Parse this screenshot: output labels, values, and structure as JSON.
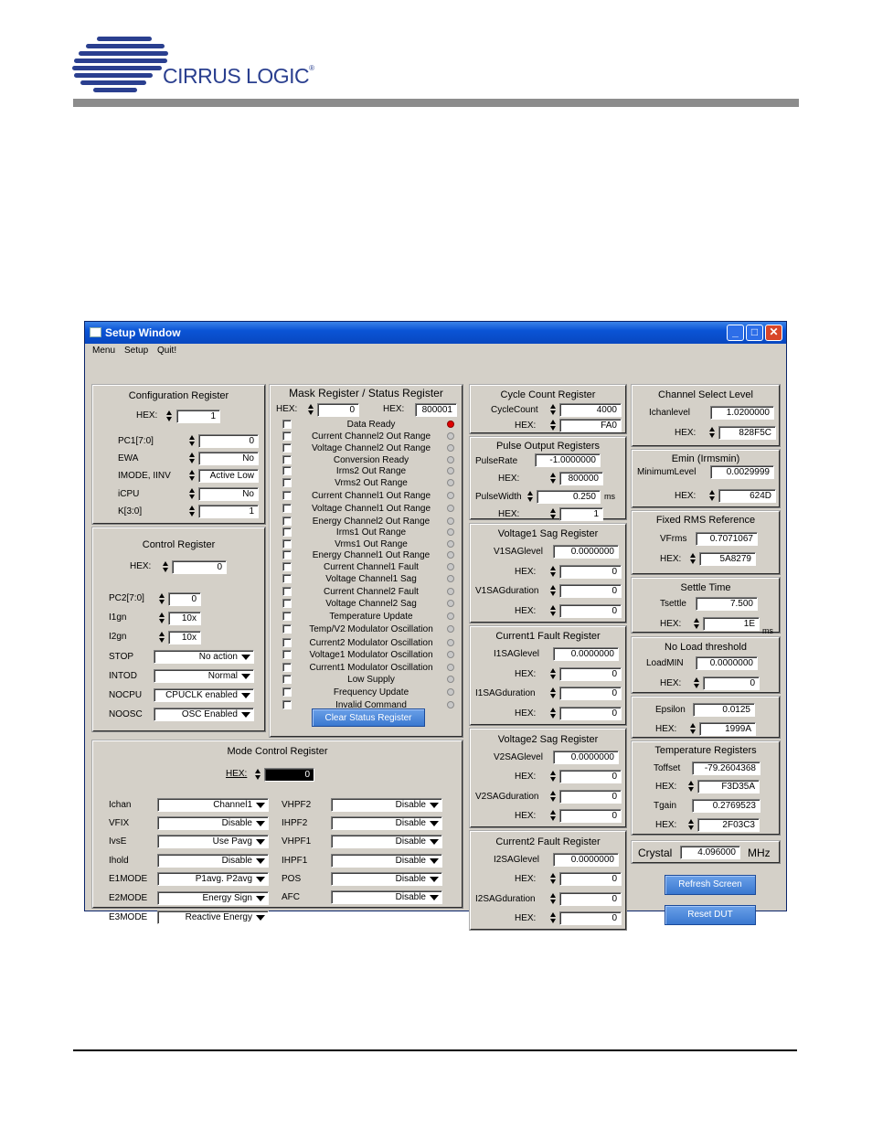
{
  "logo": {
    "text": "CIRRUS LOGIC",
    "mark": "®"
  },
  "window": {
    "title": "Setup Window",
    "minimize": "_",
    "maximize": "□",
    "close": "✕"
  },
  "menu": [
    "Menu",
    "Setup",
    "Quit!"
  ],
  "config": {
    "title": "Configuration Register",
    "hex_label": "HEX:",
    "hex": "1",
    "rows": [
      {
        "label": "PC1[7:0]",
        "value": "0",
        "type": "num"
      },
      {
        "label": "EWA",
        "value": "No",
        "type": "num"
      },
      {
        "label": "IMODE, IINV",
        "value": "Active Low",
        "type": "num"
      },
      {
        "label": "iCPU",
        "value": "No",
        "type": "num"
      },
      {
        "label": "K[3:0]",
        "value": "1",
        "type": "num"
      }
    ]
  },
  "control": {
    "title": "Control Register",
    "hex_label": "HEX:",
    "hex": "0",
    "pc2_label": "PC2[7:0]",
    "pc2": "0",
    "i1gn_label": "I1gn",
    "i1gn": "10x",
    "i2gn_label": "I2gn",
    "i2gn": "10x",
    "rings": [
      {
        "label": "STOP",
        "value": "No action"
      },
      {
        "label": "INTOD",
        "value": "Normal"
      },
      {
        "label": "NOCPU",
        "value": "CPUCLK enabled"
      },
      {
        "label": "NOOSC",
        "value": "OSC Enabled"
      }
    ]
  },
  "mask": {
    "title": "Mask Register / Status Register",
    "hex_label": "HEX:",
    "mask_hex": "0",
    "status_hex_label": "HEX:",
    "status_hex": "800001",
    "items": [
      "Data Ready",
      "Current Channel2 Out Range",
      "Voltage Channel2 Out Range",
      "Conversion Ready",
      "Irms2 Out Range",
      "Vrms2 Out Range",
      "Current Channel1 Out Range",
      "Voltage Channel1 Out Range",
      "Energy Channel2 Out Range",
      "Irms1 Out Range",
      "Vrms1 Out Range",
      "Energy Channel1 Out Range",
      "Current Channel1 Fault",
      "Voltage Channel1 Sag",
      "Current Channel2 Fault",
      "Voltage Channel2 Sag",
      "Temperature Update",
      "Temp/V2 Modulator Oscillation",
      "Current2 Modulator Oscillation",
      "Voltage1 Modulator Oscillation",
      "Current1 Modulator Oscillation",
      "Low Supply",
      "Frequency Update",
      "Invalid Command"
    ],
    "clear_button": "Clear Status Register"
  },
  "mode": {
    "title": "Mode Control Register",
    "hex_label": "HEX:",
    "hex": "0",
    "left": [
      {
        "label": "Ichan",
        "value": "Channel1"
      },
      {
        "label": "VFIX",
        "value": "Disable"
      },
      {
        "label": "IvsE",
        "value": "Use Pavg"
      },
      {
        "label": "Ihold",
        "value": "Disable"
      },
      {
        "label": "E1MODE",
        "value": "P1avg. P2avg"
      },
      {
        "label": "E2MODE",
        "value": "Energy Sign"
      },
      {
        "label": "E3MODE",
        "value": "Reactive Energy"
      }
    ],
    "right": [
      {
        "label": "VHPF2",
        "value": "Disable"
      },
      {
        "label": "IHPF2",
        "value": "Disable"
      },
      {
        "label": "VHPF1",
        "value": "Disable"
      },
      {
        "label": "IHPF1",
        "value": "Disable"
      },
      {
        "label": "POS",
        "value": "Disable"
      },
      {
        "label": "AFC",
        "value": "Disable"
      }
    ]
  },
  "cycle": {
    "title": "Cycle Count Register",
    "count_label": "CycleCount",
    "count": "4000",
    "hex_label": "HEX:",
    "hex": "FA0"
  },
  "pulse": {
    "title": "Pulse Output Registers",
    "rate_label": "PulseRate",
    "rate": "-1.0000000",
    "hex_label": "HEX:",
    "hex": "800000",
    "width_label": "PulseWidth",
    "width": "0.250",
    "width_unit": "ms",
    "hex2_label": "HEX:",
    "hex2": "1"
  },
  "v1sag": {
    "title": "Voltage1 Sag Register",
    "level_label": "V1SAGlevel",
    "level": "0.0000000",
    "hex_label": "HEX:",
    "hex": "0",
    "dur_label": "V1SAGduration",
    "dur": "0",
    "hex2_label": "HEX:",
    "hex2": "0"
  },
  "i1fault": {
    "title": "Current1 Fault Register",
    "level_label": "I1SAGlevel",
    "level": "0.0000000",
    "hex_label": "HEX:",
    "hex": "0",
    "dur_label": "I1SAGduration",
    "dur": "0",
    "hex2_label": "HEX:",
    "hex2": "0"
  },
  "v2sag": {
    "title": "Voltage2 Sag Register",
    "level_label": "V2SAGlevel",
    "level": "0.0000000",
    "hex_label": "HEX:",
    "hex": "0",
    "dur_label": "V2SAGduration",
    "dur": "0",
    "hex2_label": "HEX:",
    "hex2": "0"
  },
  "i2fault": {
    "title": "Current2 Fault Register",
    "level_label": "I2SAGlevel",
    "level": "0.0000000",
    "hex_label": "HEX:",
    "hex": "0",
    "dur_label": "I2SAGduration",
    "dur": "0",
    "hex2_label": "HEX:",
    "hex2": "0"
  },
  "chansel": {
    "title": "Channel Select Level",
    "lvl_label": "Ichanlevel",
    "lvl": "1.0200000",
    "hex_label": "HEX:",
    "hex": "828F5C"
  },
  "emin": {
    "title": "Emin (Irmsmin)",
    "lvl_label": "MinimumLevel",
    "lvl": "0.0029999",
    "hex_label": "HEX:",
    "hex": "624D"
  },
  "fixedrms": {
    "title": "Fixed RMS Reference",
    "lvl_label": "VFrms",
    "lvl": "0.7071067",
    "hex_label": "HEX:",
    "hex": "5A8279"
  },
  "settle": {
    "title": "Settle Time",
    "lvl_label": "Tsettle",
    "lvl": "7.500",
    "hex_label": "HEX:",
    "hex": "1E",
    "unit": "ms"
  },
  "noload": {
    "title": "No Load threshold",
    "lvl_label": "LoadMIN",
    "lvl": "0.0000000",
    "hex_label": "HEX:",
    "hex": "0"
  },
  "epsilon": {
    "lvl_label": "Epsilon",
    "lvl": "0.0125",
    "hex_label": "HEX:",
    "hex": "1999A"
  },
  "temp": {
    "title": "Temperature Registers",
    "toff_label": "Toffset",
    "toff": "-79.2604368",
    "hex_label": "HEX:",
    "hex": "F3D35A",
    "tgain_label": "Tgain",
    "tgain": "0.2769523",
    "hex2_label": "HEX:",
    "hex2": "2F03C3"
  },
  "crystal": {
    "label": "Crystal",
    "value": "4.096000",
    "unit": "MHz"
  },
  "buttons": {
    "refresh": "Refresh Screen",
    "reset": "Reset DUT"
  }
}
